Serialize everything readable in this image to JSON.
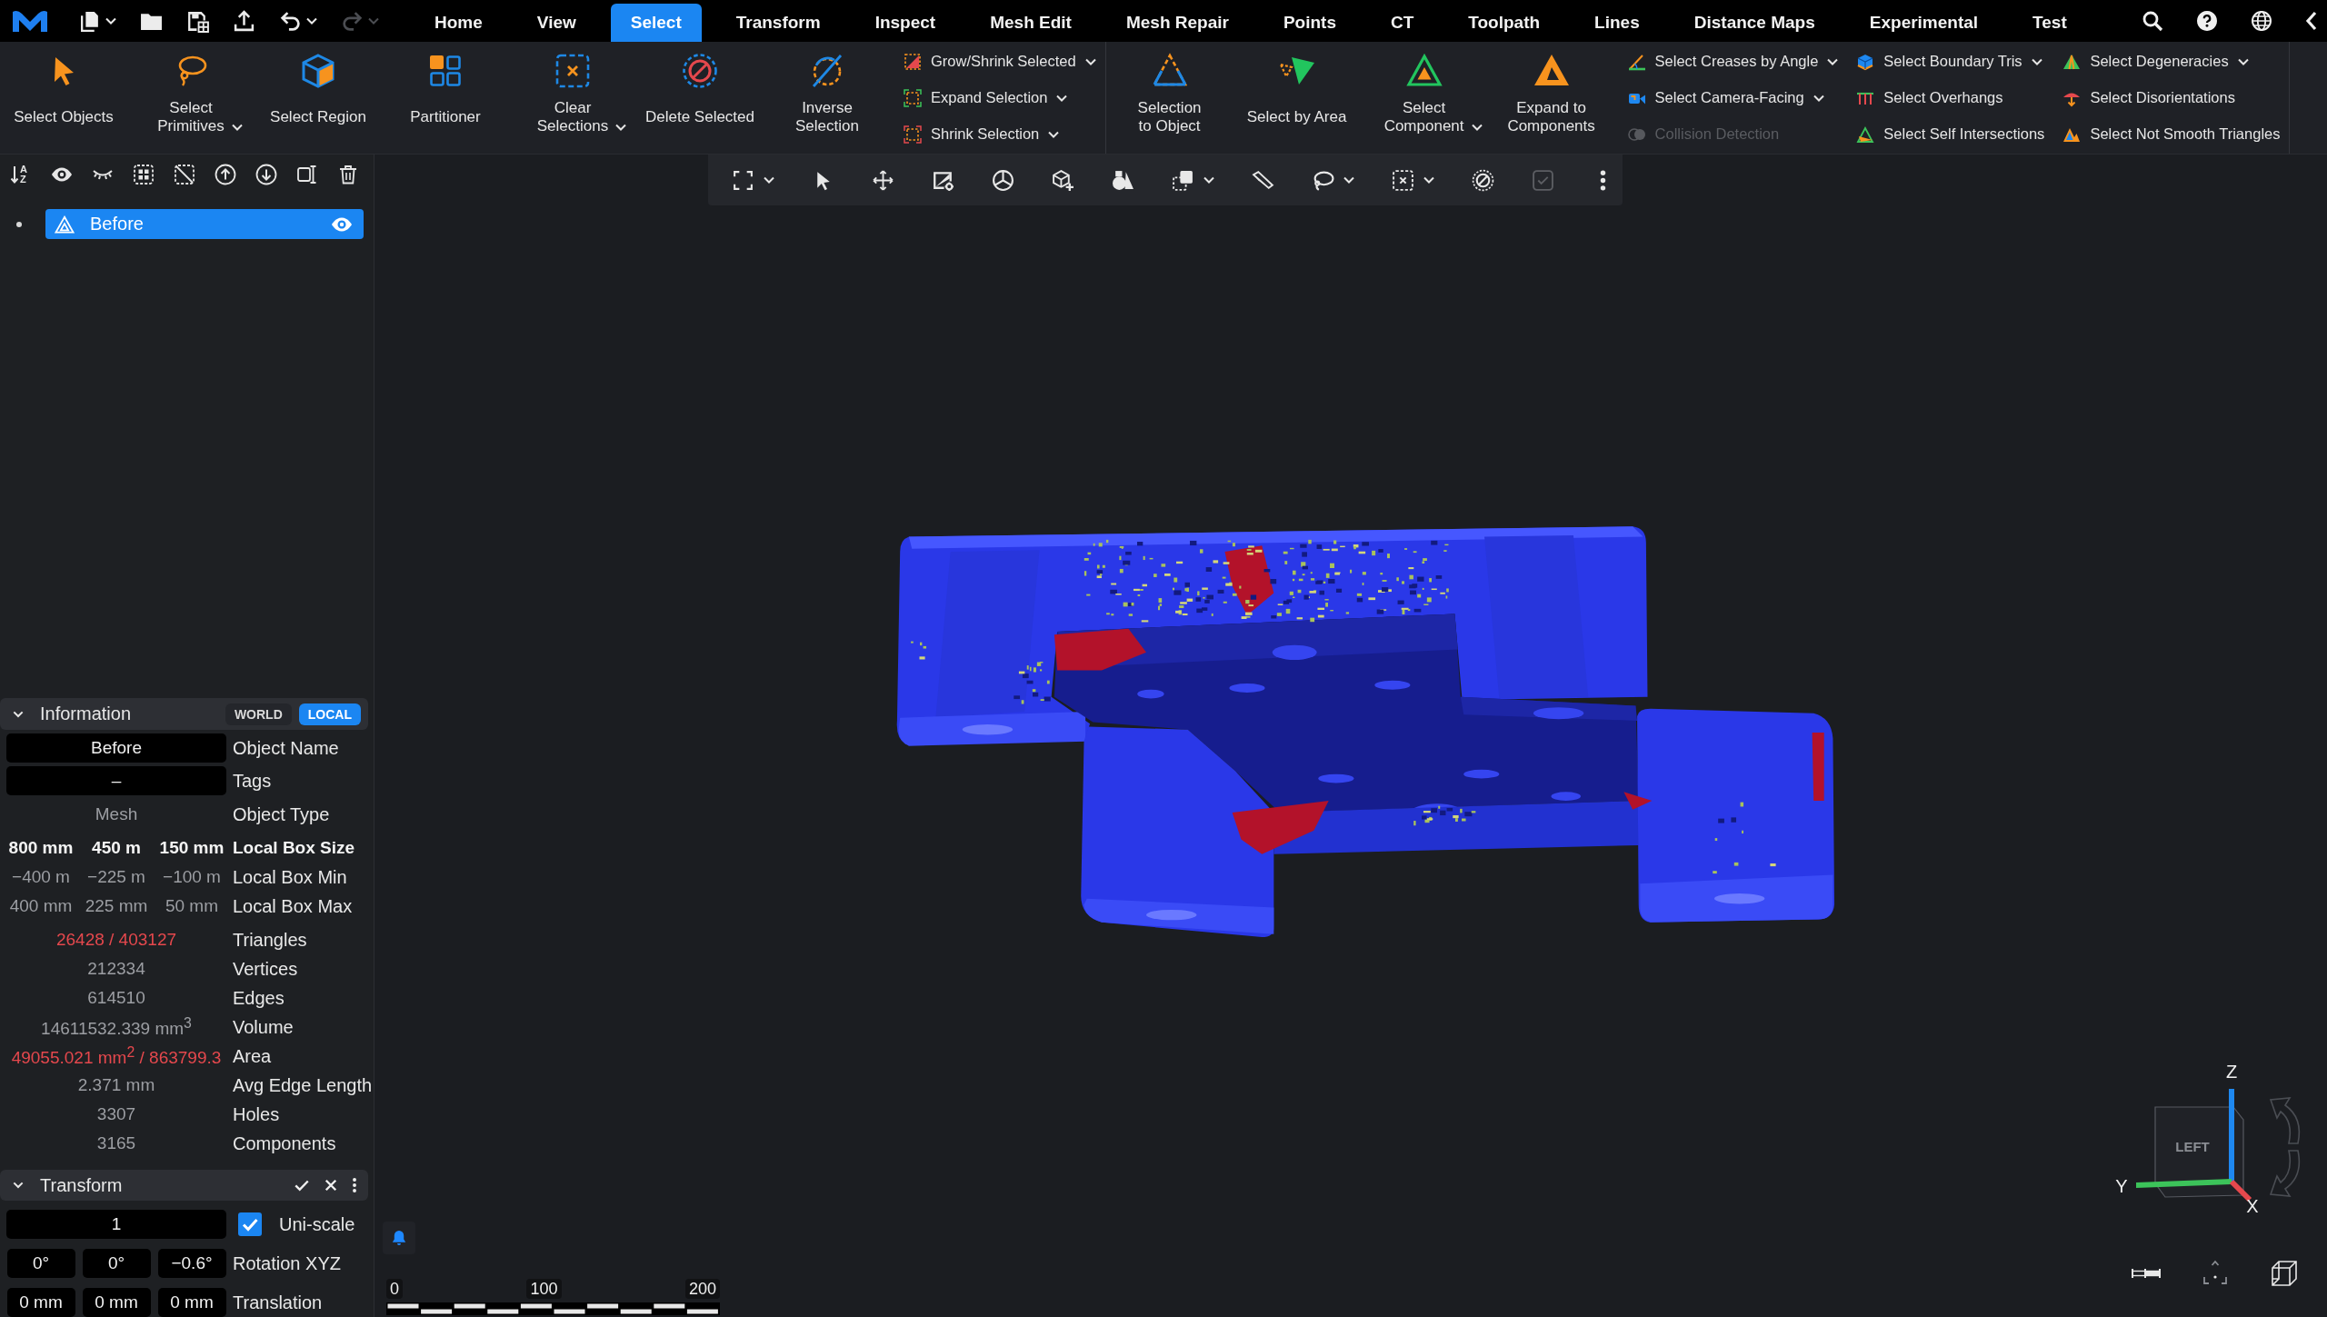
{
  "menu_bar": {
    "quick_actions": [
      {
        "caret": true,
        "disabled": false
      },
      {
        "caret": false,
        "disabled": false
      },
      {
        "caret": false,
        "disabled": false
      },
      {
        "caret": false,
        "disabled": false
      },
      {
        "caret": true,
        "disabled": false
      },
      {
        "caret": true,
        "disabled": true
      }
    ],
    "tabs": [
      {
        "label": "Home",
        "selected": false
      },
      {
        "label": "View",
        "selected": false
      },
      {
        "label": "Select",
        "selected": true
      },
      {
        "label": "Transform",
        "selected": false
      },
      {
        "label": "Inspect",
        "selected": false
      },
      {
        "label": "Mesh Edit",
        "selected": false
      },
      {
        "label": "Mesh Repair",
        "selected": false
      },
      {
        "label": "Points",
        "selected": false
      },
      {
        "label": "CT",
        "selected": false
      },
      {
        "label": "Toolpath",
        "selected": false
      },
      {
        "label": "Lines",
        "selected": false
      },
      {
        "label": "Distance Maps",
        "selected": false
      },
      {
        "label": "Experimental",
        "selected": false
      },
      {
        "label": "Test",
        "selected": false
      }
    ]
  },
  "ribbon": {
    "groups": [
      {
        "large_tools": [
          {
            "label": "Select Objects",
            "dropdown": false
          },
          {
            "label": "Select\nPrimitives",
            "dropdown": true
          },
          {
            "label": "Select Region",
            "dropdown": false
          },
          {
            "label": "Partitioner",
            "dropdown": false
          },
          {
            "label": "Clear\nSelections",
            "dropdown": true
          },
          {
            "label": "Delete Selected",
            "dropdown": false
          },
          {
            "label": "Inverse\nSelection",
            "dropdown": false
          }
        ],
        "columns": [
          [
            {
              "label": "Grow/Shrink Selected",
              "dropdown": true,
              "disabled": false
            },
            {
              "label": "Expand Selection",
              "dropdown": true,
              "disabled": false
            },
            {
              "label": "Shrink Selection",
              "dropdown": true,
              "disabled": false
            }
          ]
        ]
      },
      {
        "large_tools": [
          {
            "label": "Selection\nto Object",
            "dropdown": false
          },
          {
            "label": "Select by Area",
            "dropdown": false
          },
          {
            "label": "Select\nComponent",
            "dropdown": true
          },
          {
            "label": "Expand to\nComponents",
            "dropdown": false
          }
        ],
        "columns": [
          [
            {
              "label": "Select Creases by Angle",
              "dropdown": true,
              "disabled": false
            },
            {
              "label": "Select Camera-Facing",
              "dropdown": true,
              "disabled": false
            },
            {
              "label": "Collision Detection",
              "dropdown": false,
              "disabled": true
            }
          ],
          [
            {
              "label": "Select Boundary Tris",
              "dropdown": true,
              "disabled": false
            },
            {
              "label": "Select Overhangs",
              "dropdown": false,
              "disabled": false
            },
            {
              "label": "Select Self Intersections",
              "dropdown": false,
              "disabled": false
            }
          ],
          [
            {
              "label": "Select Degeneracies",
              "dropdown": true,
              "disabled": false
            },
            {
              "label": "Select Disorientations",
              "dropdown": false,
              "disabled": false
            },
            {
              "label": "Select Not Smooth Triangles",
              "dropdown": false,
              "disabled": false
            }
          ]
        ]
      }
    ]
  },
  "outliner": {
    "sort_letters": [
      "A",
      "Z"
    ],
    "items": [
      {
        "label": "Before",
        "selected": true,
        "visible": true
      }
    ]
  },
  "information": {
    "title": "Information",
    "expanded": true,
    "space_toggle": [
      {
        "label": "WORLD",
        "selected": false
      },
      {
        "label": "LOCAL",
        "selected": true
      }
    ],
    "rows": [
      {
        "kind": "field",
        "values": [
          "Before"
        ],
        "label": "Object Name",
        "highlight": false
      },
      {
        "kind": "field",
        "values": [
          "–"
        ],
        "label": "Tags",
        "highlight": false
      },
      {
        "kind": "text",
        "values": [
          "Mesh"
        ],
        "label": "Object Type",
        "highlight": false
      },
      {
        "kind": "dimensions",
        "values": [
          "800 mm",
          "450 m",
          "150 mm"
        ],
        "label": "Local Box Size",
        "highlight": false
      },
      {
        "kind": "bounds",
        "values": [
          "−400 m",
          "−225 m",
          "−100 m"
        ],
        "label": "Local Box Min",
        "highlight": false
      },
      {
        "kind": "bounds",
        "values": [
          "400 mm",
          "225 mm",
          "50 mm"
        ],
        "label": "Local Box Max",
        "highlight": false
      },
      {
        "kind": "text",
        "values": [
          "26428 / 403127"
        ],
        "label": "Triangles",
        "highlight": true
      },
      {
        "kind": "text",
        "values": [
          "212334"
        ],
        "label": "Vertices",
        "highlight": false
      },
      {
        "kind": "text",
        "values": [
          "614510"
        ],
        "label": "Edges",
        "highlight": false
      },
      {
        "kind": "text",
        "values": [
          "14611532.339 mm$^{3}$"
        ],
        "label": "Volume",
        "highlight": false
      },
      {
        "kind": "text",
        "values": [
          "49055.021 mm$^{2}$ / 863799.3"
        ],
        "label": "Area",
        "highlight": true
      },
      {
        "kind": "text",
        "values": [
          "2.371 mm"
        ],
        "label": "Avg Edge Length",
        "highlight": false
      },
      {
        "kind": "text",
        "values": [
          "3307"
        ],
        "label": "Holes",
        "highlight": false
      },
      {
        "kind": "text",
        "values": [
          "3165"
        ],
        "label": "Components",
        "highlight": false
      }
    ]
  },
  "transform": {
    "title": "Transform",
    "expanded": true,
    "rows": [
      {
        "kind": "scale",
        "values": [
          "1"
        ],
        "checkbox": {
          "label": "Uni-scale",
          "checked": true
        }
      },
      {
        "kind": "vector",
        "values": [
          "0°",
          "0°",
          "−0.6°"
        ],
        "label": "Rotation XYZ"
      },
      {
        "kind": "vector",
        "values": [
          "0 mm",
          "0 mm",
          "0 mm"
        ],
        "label": "Translation"
      }
    ]
  },
  "viewport": {
    "toolbar": [
      {
        "caret": true,
        "disabled": false
      },
      {
        "caret": false,
        "disabled": false
      },
      {
        "caret": false,
        "disabled": false
      },
      {
        "caret": false,
        "disabled": false
      },
      {
        "caret": false,
        "disabled": false
      },
      {
        "caret": false,
        "disabled": false
      },
      {
        "caret": false,
        "disabled": false
      },
      {
        "caret": true,
        "disabled": false
      },
      {
        "caret": false,
        "disabled": false
      },
      {
        "caret": true,
        "disabled": false
      },
      {
        "caret": true,
        "disabled": false
      },
      {
        "caret": false,
        "disabled": false
      },
      {
        "caret": false,
        "disabled": true
      },
      {
        "caret": false,
        "disabled": false
      }
    ],
    "scale_bar": {
      "labels": [
        "0",
        "100",
        "200"
      ]
    },
    "view_cube": {
      "face": "LEFT",
      "axes": [
        {
          "label": "Z",
          "color": "#1e88f0"
        },
        {
          "label": "Y",
          "color": "#3cc35a"
        },
        {
          "label": "X",
          "color": "#e5484d"
        }
      ]
    }
  }
}
